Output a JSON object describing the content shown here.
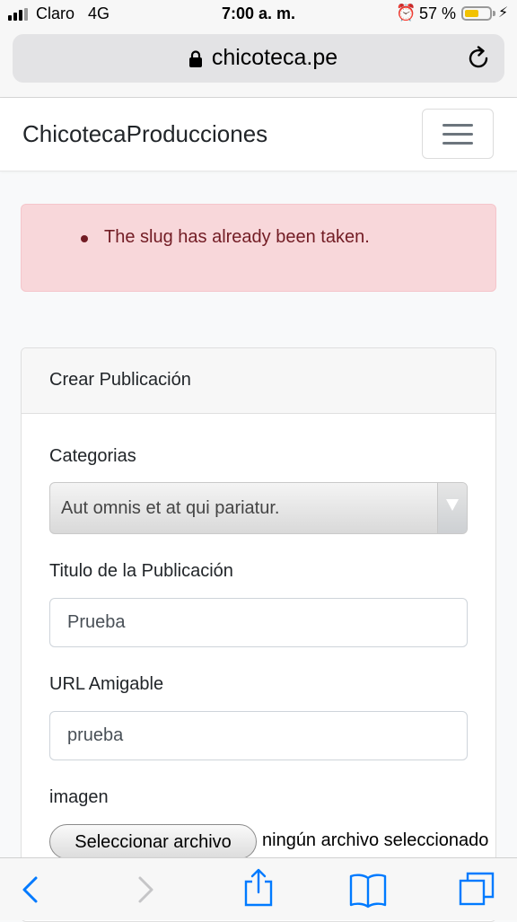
{
  "status_bar": {
    "carrier": "Claro",
    "network": "4G",
    "time": "7:00 a. m.",
    "battery_percent": "57 %",
    "battery_level": 0.57,
    "battery_color": "#f2c200",
    "icons": [
      "signal-icon",
      "alarm-icon",
      "battery-icon",
      "charging-bolt-icon"
    ]
  },
  "browser": {
    "url": "chicoteca.pe",
    "icons": [
      "lock-icon",
      "reload-icon"
    ]
  },
  "navbar": {
    "brand": "ChicotecaProducciones",
    "toggler_icon": "hamburger-menu-icon"
  },
  "alert": {
    "messages": [
      "The slug has already been taken."
    ],
    "colors": {
      "background": "#f8d7da",
      "text": "#721c24"
    }
  },
  "form": {
    "title": "Crear Publicación",
    "category": {
      "label": "Categorias",
      "selected": "Aut omnis et at qui pariatur."
    },
    "title_field": {
      "label": "Titulo de la Publicación",
      "value": "Prueba"
    },
    "slug_field": {
      "label": "URL Amigable",
      "value": "prueba"
    },
    "image_field": {
      "label": "imagen",
      "button_label": "Seleccionar archivo",
      "status": "ningún archivo seleccionado"
    }
  },
  "toolbar": {
    "icons": [
      "back-icon",
      "forward-icon",
      "share-icon",
      "bookmarks-icon",
      "tabs-icon"
    ],
    "accent": "#007aff"
  }
}
